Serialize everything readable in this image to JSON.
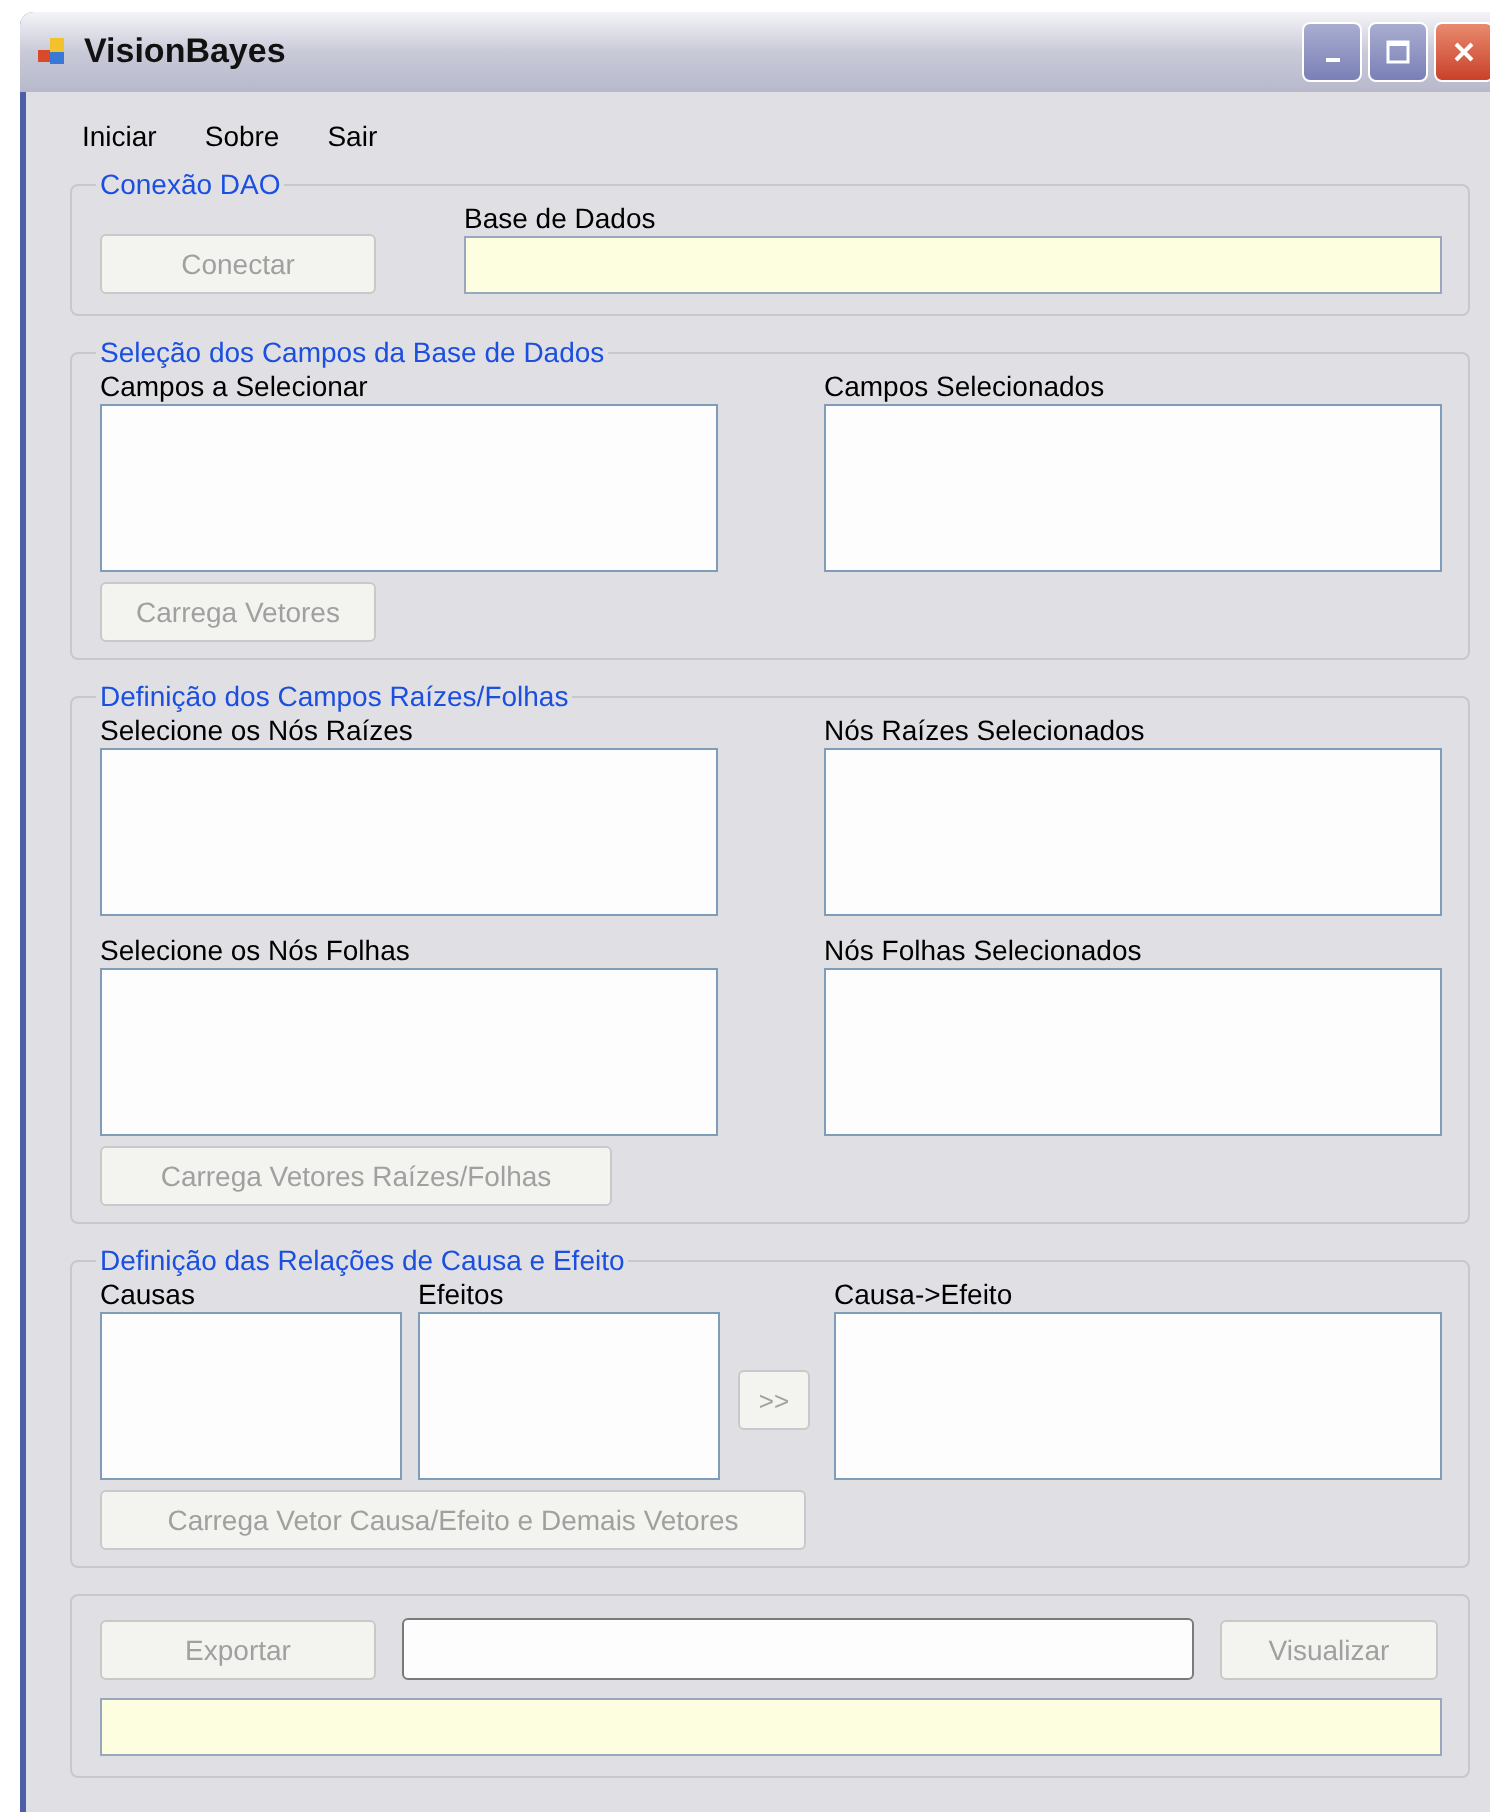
{
  "window": {
    "title": "VisionBayes"
  },
  "menu": [
    "Iniciar",
    "Sobre",
    "Sair"
  ],
  "connection": {
    "title": "Conexão DAO",
    "button": {
      "label": "Conectar",
      "disabled": true
    },
    "field_label": "Base de Dados"
  },
  "field_selection": {
    "title": "Seleção dos Campos da Base de Dados",
    "left_label": "Campos a Selecionar",
    "right_label": "Campos Selecionados",
    "button": {
      "label": "Carrega Vetores",
      "disabled": true
    }
  },
  "roots_leaves": {
    "title": "Definição dos Campos Raízes/Folhas",
    "lists": [
      {
        "label": "Selecione os Nós Raízes"
      },
      {
        "label": "Nós Raízes Selecionados"
      },
      {
        "label": "Selecione os Nós Folhas"
      },
      {
        "label": "Nós Folhas Selecionados"
      }
    ],
    "button": {
      "label": "Carrega Vetores Raízes/Folhas",
      "disabled": true
    }
  },
  "cause_effect": {
    "title": "Definição das Relações de Causa e Efeito",
    "causes_label": "Causas",
    "effects_label": "Efeitos",
    "move_button": {
      "label": ">>",
      "disabled": true
    },
    "result_label": "Causa->Efeito",
    "button": {
      "label": "Carrega Vetor Causa/Efeito e Demais Vetores",
      "disabled": true
    }
  },
  "export": {
    "export_button": {
      "label": "Exportar",
      "disabled": true
    },
    "view_button": {
      "label": "Visualizar",
      "disabled": true
    }
  }
}
